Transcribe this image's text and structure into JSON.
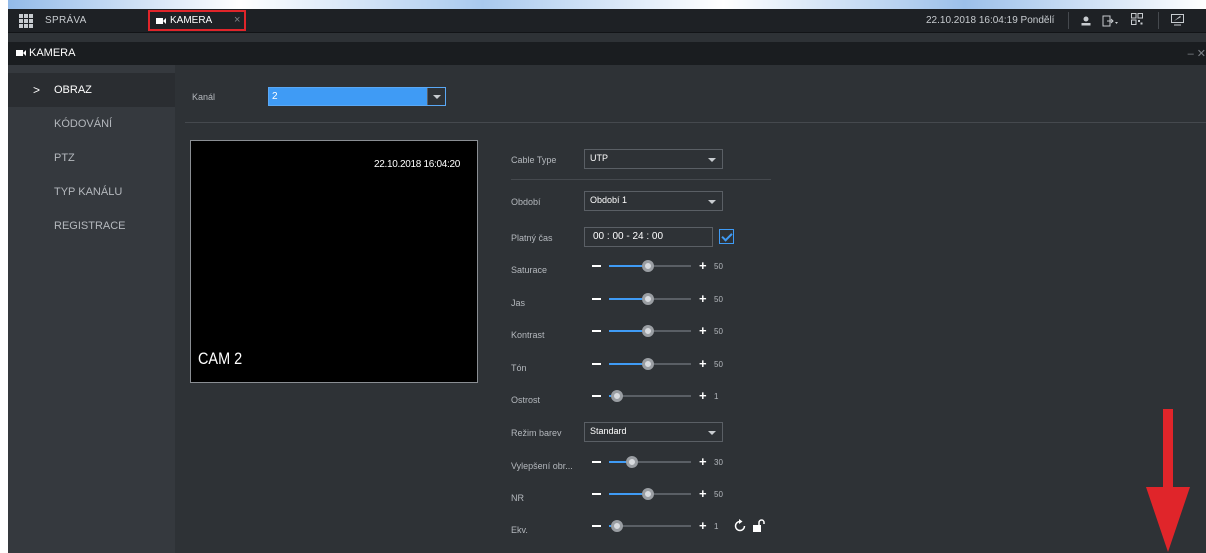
{
  "topbar": {
    "sprava_label": "SPRÁVA",
    "tab_label": "KAMERA",
    "tab_close": "×",
    "datetime": "22.10.2018 16:04:19 Pondělí",
    "icons": [
      "user-icon",
      "logout-icon",
      "qr-icon",
      "display-icon"
    ]
  },
  "header": {
    "title": "KAMERA",
    "controls": "– ✕"
  },
  "sidebar": {
    "items": [
      {
        "label": "OBRAZ",
        "active": true
      },
      {
        "label": "KÓDOVÁNÍ",
        "active": false
      },
      {
        "label": "PTZ",
        "active": false
      },
      {
        "label": "TYP KANÁLU",
        "active": false
      },
      {
        "label": "REGISTRACE",
        "active": false
      }
    ],
    "chevron": ">"
  },
  "main": {
    "kanal_label": "Kanál",
    "kanal_value": "2",
    "preview_timestamp": "22.10.2018 16:04:20",
    "preview_camera": "CAM 2",
    "cable_type_label": "Cable Type",
    "cable_type_value": "UTP",
    "obdobi_label": "Období",
    "obdobi_value": "Období 1",
    "platny_cas_label": "Platný čas",
    "platny_cas_value": "00 : 00  -  24 : 00",
    "platny_cas_checked": true,
    "rezim_barev_label": "Režim barev",
    "rezim_barev_value": "Standard",
    "sliders": [
      {
        "label": "Saturace",
        "value": "50"
      },
      {
        "label": "Jas",
        "value": "50"
      },
      {
        "label": "Kontrast",
        "value": "50"
      },
      {
        "label": "Tón",
        "value": "50"
      },
      {
        "label": "Ostrost",
        "value": "1"
      },
      {
        "label": "Vylepšení obr...",
        "value": "30"
      },
      {
        "label": "NR",
        "value": "50"
      },
      {
        "label": "Ekv.",
        "value": "1"
      }
    ]
  },
  "colors": {
    "accent": "#3f9bf5",
    "annotation_red": "#e0252a",
    "background": "#2e3236",
    "sidebar": "#35393e"
  }
}
